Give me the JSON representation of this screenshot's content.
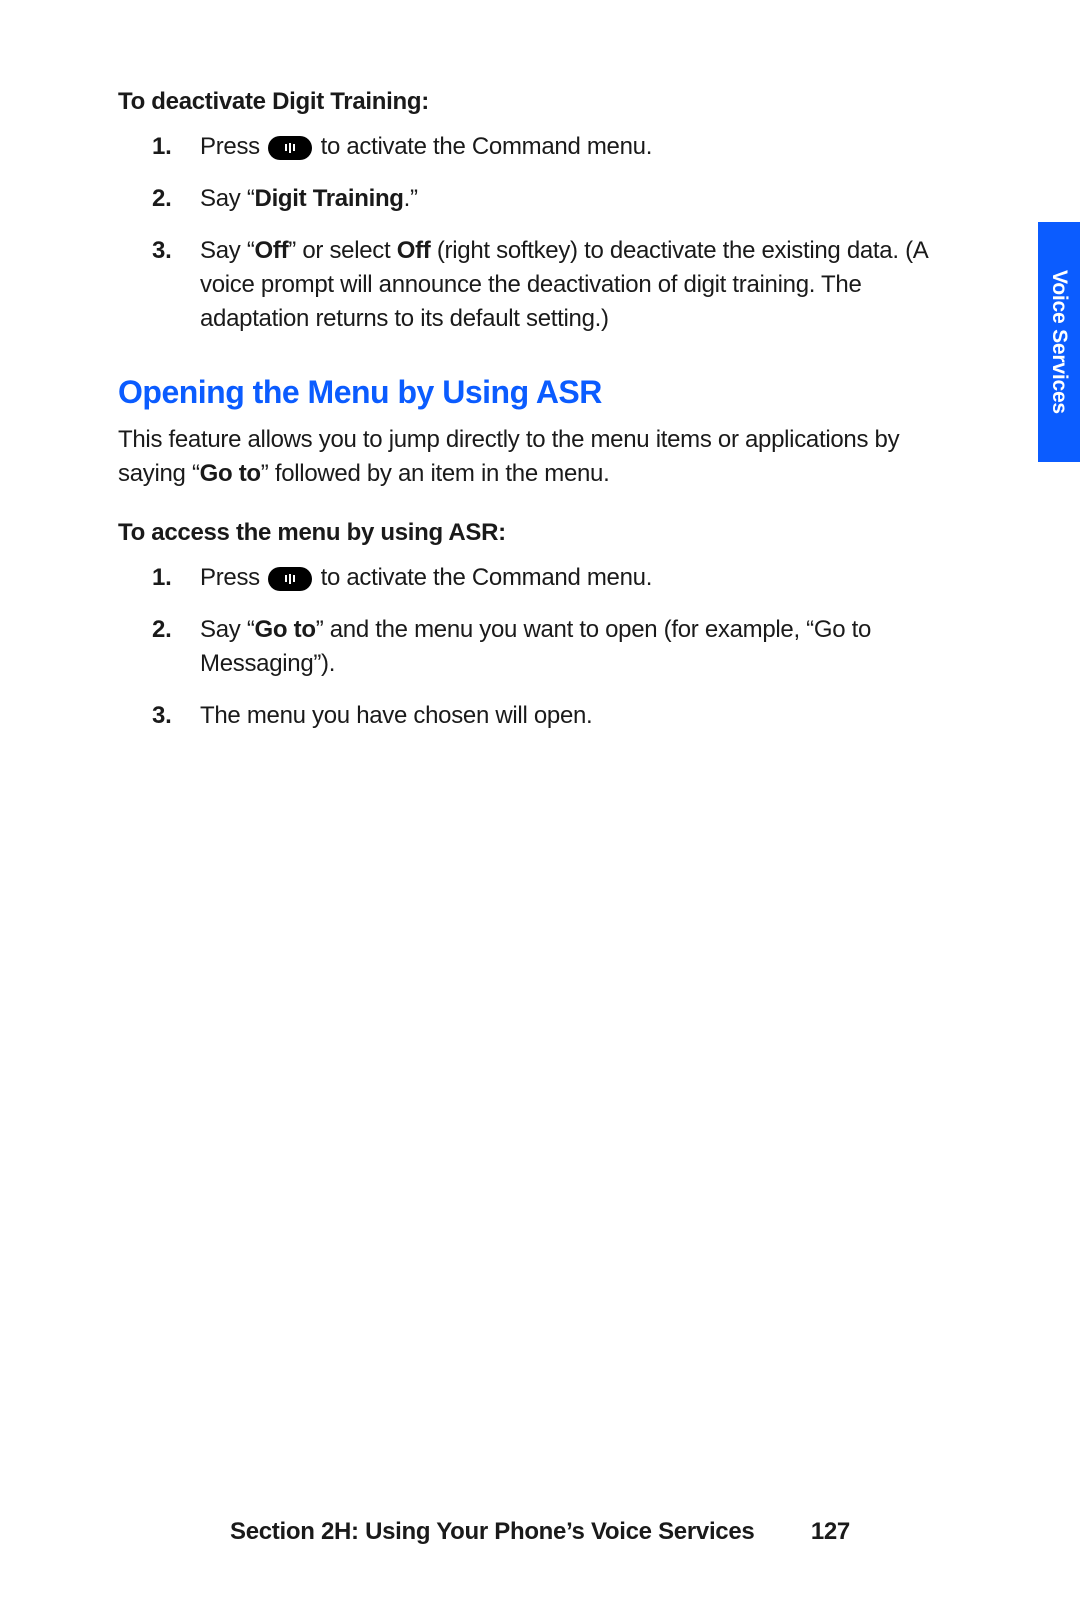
{
  "sideTab": "Voice Services",
  "sectionA": {
    "title": "To deactivate Digit Training:",
    "step1_pre": "Press ",
    "step1_post": " to activate the Command menu.",
    "step2_pre": "Say “",
    "step2_bold": "Digit Training",
    "step2_post": ".”",
    "step3_a": "Say “",
    "step3_b": "Off",
    "step3_c": "” or select ",
    "step3_d": "Off",
    "step3_e": " (right softkey) to deactivate the existing data. (A voice prompt will announce the deactivation of digit training. The adaptation returns to its default setting.)"
  },
  "heading2": "Opening the Menu by Using ASR",
  "intro_a": "This feature allows you to jump directly to the menu items or applications by saying “",
  "intro_b": "Go to",
  "intro_c": "” followed by an item in the menu.",
  "sectionB": {
    "title": "To access the menu by using ASR:",
    "step1_pre": "Press ",
    "step1_post": " to activate the Command menu.",
    "step2_a": "Say “",
    "step2_b": "Go to",
    "step2_c": "” and the menu you want to open (for example, “Go to Messaging”).",
    "step3": "The menu you have chosen will open."
  },
  "footer": {
    "title": "Section 2H: Using Your Phone’s Voice Services",
    "page": "127"
  }
}
